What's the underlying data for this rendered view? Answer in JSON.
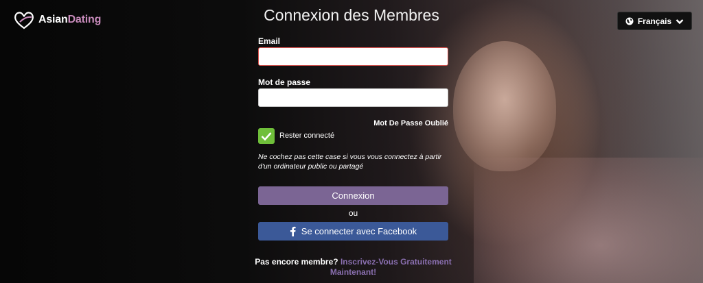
{
  "brand": {
    "name_part1": "Asian",
    "name_part2": "Dating"
  },
  "language": {
    "selected": "Français",
    "icon": "globe-icon",
    "caret_icon": "chevron-down-icon"
  },
  "form": {
    "title": "Connexion des Membres",
    "email_label": "Email",
    "email_value": "",
    "password_label": "Mot de passe",
    "password_value": "",
    "forgot_link": "Mot De Passe Oublié",
    "remember_label": "Rester connecté",
    "remember_checked": true,
    "note": "Ne cochez pas cette case si vous vous connectez à partir d'un ordinateur public ou partagé",
    "login_button": "Connexion",
    "or_text": "ou",
    "facebook_button": "Se connecter avec Facebook"
  },
  "signup": {
    "prompt": "Pas encore membre?",
    "link": "Inscrivez-Vous Gratuitement Maintenant!"
  },
  "colors": {
    "brand_accent": "#c88bbb",
    "login_button": "#7b6594",
    "facebook_button": "#3b5998",
    "checkbox": "#6fbf3a",
    "signup_link": "#8a6fb0"
  }
}
